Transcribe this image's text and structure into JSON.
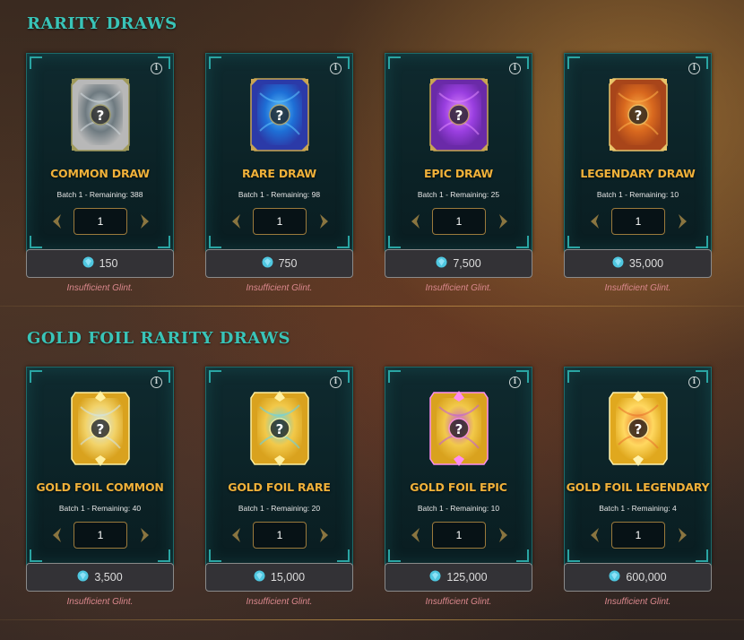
{
  "sections": [
    {
      "title": "RARITY DRAWS",
      "cards": [
        {
          "title": "COMMON DRAW",
          "batch": "Batch 1 - Remaining: 388",
          "qty": "1",
          "price": "150",
          "status": "Insufficient Glint.",
          "art": {
            "frame": "#b8b8b8",
            "inner": "#6e7a80",
            "glow": "#d6dde0",
            "accent": "#a09a5a"
          }
        },
        {
          "title": "RARE DRAW",
          "batch": "Batch 1 - Remaining: 98",
          "qty": "1",
          "price": "750",
          "status": "Insufficient Glint.",
          "art": {
            "frame": "#2b3aa8",
            "inner": "#1e6fd6",
            "glow": "#62c9ff",
            "accent": "#c9a552"
          }
        },
        {
          "title": "EPIC DRAW",
          "batch": "Batch 1 - Remaining: 25",
          "qty": "1",
          "price": "7,500",
          "status": "Insufficient Glint.",
          "art": {
            "frame": "#6a2aa8",
            "inner": "#9a3fe0",
            "glow": "#e28bff",
            "accent": "#c9a552"
          }
        },
        {
          "title": "LEGENDARY DRAW",
          "batch": "Batch 1 - Remaining: 10",
          "qty": "1",
          "price": "35,000",
          "status": "Insufficient Glint.",
          "art": {
            "frame": "#a8451a",
            "inner": "#d8681e",
            "glow": "#ffb24a",
            "accent": "#e8c46a"
          }
        }
      ]
    },
    {
      "title": "GOLD FOIL RARITY DRAWS",
      "cards": [
        {
          "title": "GOLD FOIL COMMON",
          "batch": "Batch 1 - Remaining: 40",
          "qty": "1",
          "price": "3,500",
          "status": "Insufficient Glint.",
          "art": {
            "frame": "#d9a21e",
            "inner": "#f2d36a",
            "glow": "#cfe6ef",
            "accent": "#fff0a0"
          }
        },
        {
          "title": "GOLD FOIL RARE",
          "batch": "Batch 1 - Remaining: 20",
          "qty": "1",
          "price": "15,000",
          "status": "Insufficient Glint.",
          "art": {
            "frame": "#d9a21e",
            "inner": "#f2c94a",
            "glow": "#5ed3f0",
            "accent": "#fff0a0"
          }
        },
        {
          "title": "GOLD FOIL EPIC",
          "batch": "Batch 1 - Remaining: 10",
          "qty": "1",
          "price": "125,000",
          "status": "Insufficient Glint.",
          "art": {
            "frame": "#d9a21e",
            "inner": "#f2c94a",
            "glow": "#c05ae0",
            "accent": "#ff8ef0"
          }
        },
        {
          "title": "GOLD FOIL LEGENDARY",
          "batch": "Batch 1 - Remaining: 4",
          "qty": "1",
          "price": "600,000",
          "status": "Insufficient Glint.",
          "art": {
            "frame": "#e0a81e",
            "inner": "#ffd860",
            "glow": "#e8702a",
            "accent": "#fff3b0"
          }
        }
      ]
    }
  ],
  "colors": {
    "accent": "#39c4b8",
    "title_gold": "#f0b13a",
    "error": "#d9878c",
    "gem": "#4fc7e0"
  },
  "icons": [
    "info-icon",
    "chevron-left-icon",
    "chevron-right-icon",
    "glint-gem-icon",
    "card-back-icon"
  ]
}
